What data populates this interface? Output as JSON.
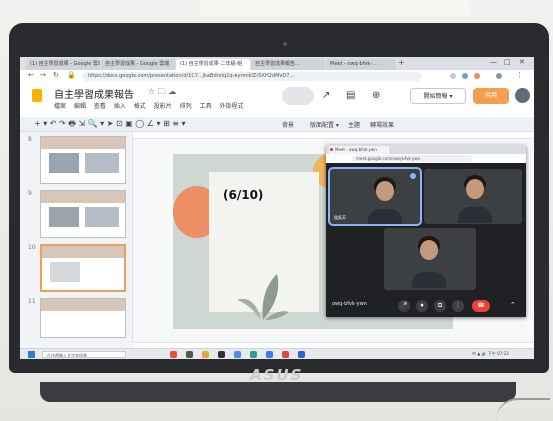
{
  "browser": {
    "tabs": [
      {
        "label": "(1) 自主學習成果 - Google 雲端",
        "active": false
      },
      {
        "label": "自主學習成果 - Google 雲端",
        "active": false
      },
      {
        "label": "(1) 自主學習成果-二年級-組",
        "active": true
      },
      {
        "label": "自主學習成果報告...",
        "active": false
      },
      {
        "label": "Meet - owq-bfvk-...",
        "active": false
      }
    ],
    "new_tab": "+",
    "url": "https://docs.google.com/presentation/d/1C7...jkaBdrxIq1q-eyrmiklZrSXH2dMvD7...",
    "window_controls": [
      "—",
      "□",
      "✕"
    ]
  },
  "slides": {
    "title": "自主學習成果報告",
    "title_icons": "☆ 🗀 ☁",
    "menu": [
      "檔案",
      "編輯",
      "查看",
      "插入",
      "格式",
      "投影片",
      "排列",
      "工具",
      "外掛程式"
    ],
    "present_label": "開始簡報 ▾",
    "share_label": "共用",
    "toolbar": {
      "icons": "+ ▾ ↶ ↷ 🖶 ⇲  🔍 ▾  ➤ ⊡ ▣ ◯ ∠ ▾ ⊞ ≡ ▾",
      "items": [
        "背景",
        "版面配置 ▾",
        "主題",
        "轉場效果"
      ]
    },
    "filmstrip": [
      {
        "num": "8"
      },
      {
        "num": "9"
      },
      {
        "num": "10",
        "selected": true
      },
      {
        "num": "11"
      }
    ],
    "current_slide_text": "(6/10)"
  },
  "meet": {
    "tab_label": "Meet - owq-bfvk-ywn",
    "url": "meet.google.com/owq-bfvk-ywn",
    "self_name": "owq-bfvk-ywn",
    "tiles": [
      {
        "name": "侯鈺芳",
        "speaking": true
      },
      {
        "name": ""
      },
      {
        "name": ""
      }
    ],
    "controls": [
      "🎤",
      "⏺",
      "⧉",
      "⋮",
      "☎"
    ],
    "chevron": "⌃"
  },
  "taskbar": {
    "search_placeholder": "在這裡輸入文字來搜尋",
    "tray": "中 ▲ 🔊  下午 07:23"
  },
  "hardware": {
    "brand": "ASUS"
  },
  "colors": {
    "accent_share": "#f59e52",
    "slide_orange": "#ed8e66",
    "meet_end_call": "#ea4335",
    "meet_speaking": "#8ab4f8"
  }
}
